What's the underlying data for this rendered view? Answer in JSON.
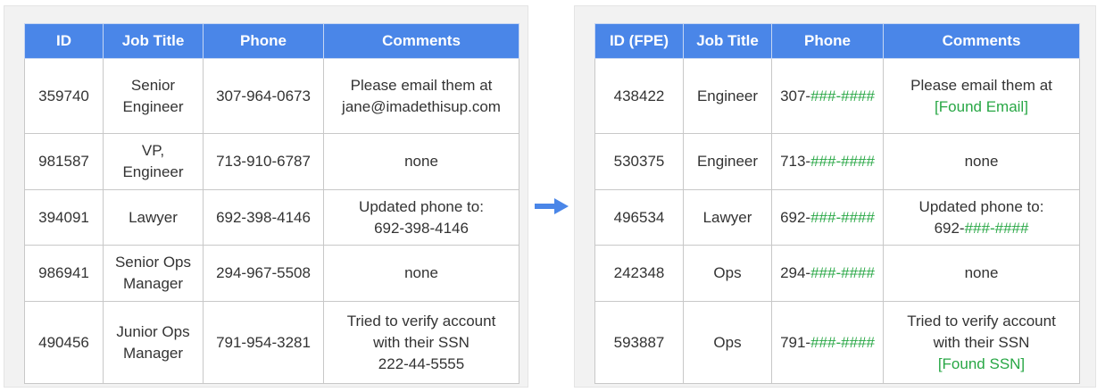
{
  "colors": {
    "header_bg": "#4a86e8",
    "header_text": "#ffffff",
    "redaction": "#28a745",
    "arrow": "#4a86e8"
  },
  "arrow_icon": "right-arrow-icon",
  "left_table": {
    "headers": [
      "ID",
      "Job Title",
      "Phone",
      "Comments"
    ],
    "rows": [
      {
        "id": "359740",
        "title": [
          "Senior",
          "Engineer"
        ],
        "phone": "307-964-0673",
        "comments": [
          "Please email them at",
          "jane@imadethisup.com"
        ]
      },
      {
        "id": "981587",
        "title": [
          "VP,",
          "Engineer"
        ],
        "phone": "713-910-6787",
        "comments": [
          "none"
        ]
      },
      {
        "id": "394091",
        "title": [
          "Lawyer"
        ],
        "phone": "692-398-4146",
        "comments": [
          "Updated phone to:",
          "692-398-4146"
        ]
      },
      {
        "id": "986941",
        "title": [
          "Senior Ops",
          "Manager"
        ],
        "phone": "294-967-5508",
        "comments": [
          "none"
        ]
      },
      {
        "id": "490456",
        "title": [
          "Junior Ops",
          "Manager"
        ],
        "phone": "791-954-3281",
        "comments": [
          "Tried to verify account",
          "with their SSN",
          "222-44-5555"
        ]
      }
    ]
  },
  "right_table": {
    "headers": [
      "ID (FPE)",
      "Job Title",
      "Phone",
      "Comments"
    ],
    "rows": [
      {
        "id": "438422",
        "title": "Engineer",
        "phone_prefix": "307-",
        "phone_masked": "###-####",
        "comments": [
          {
            "text": "Please email them at"
          },
          {
            "green": "[Found Email]"
          }
        ]
      },
      {
        "id": "530375",
        "title": "Engineer",
        "phone_prefix": "713-",
        "phone_masked": "###-####",
        "comments": [
          {
            "text": "none"
          }
        ]
      },
      {
        "id": "496534",
        "title": "Lawyer",
        "phone_prefix": "692-",
        "phone_masked": "###-####",
        "comments": [
          {
            "text": "Updated phone to:"
          },
          {
            "text": "692-",
            "green": "###-####"
          }
        ]
      },
      {
        "id": "242348",
        "title": "Ops",
        "phone_prefix": "294-",
        "phone_masked": "###-####",
        "comments": [
          {
            "text": "none"
          }
        ]
      },
      {
        "id": "593887",
        "title": "Ops",
        "phone_prefix": "791-",
        "phone_masked": "###-####",
        "comments": [
          {
            "text": "Tried to verify account"
          },
          {
            "text": "with their SSN"
          },
          {
            "green": "[Found SSN]"
          }
        ]
      }
    ]
  }
}
